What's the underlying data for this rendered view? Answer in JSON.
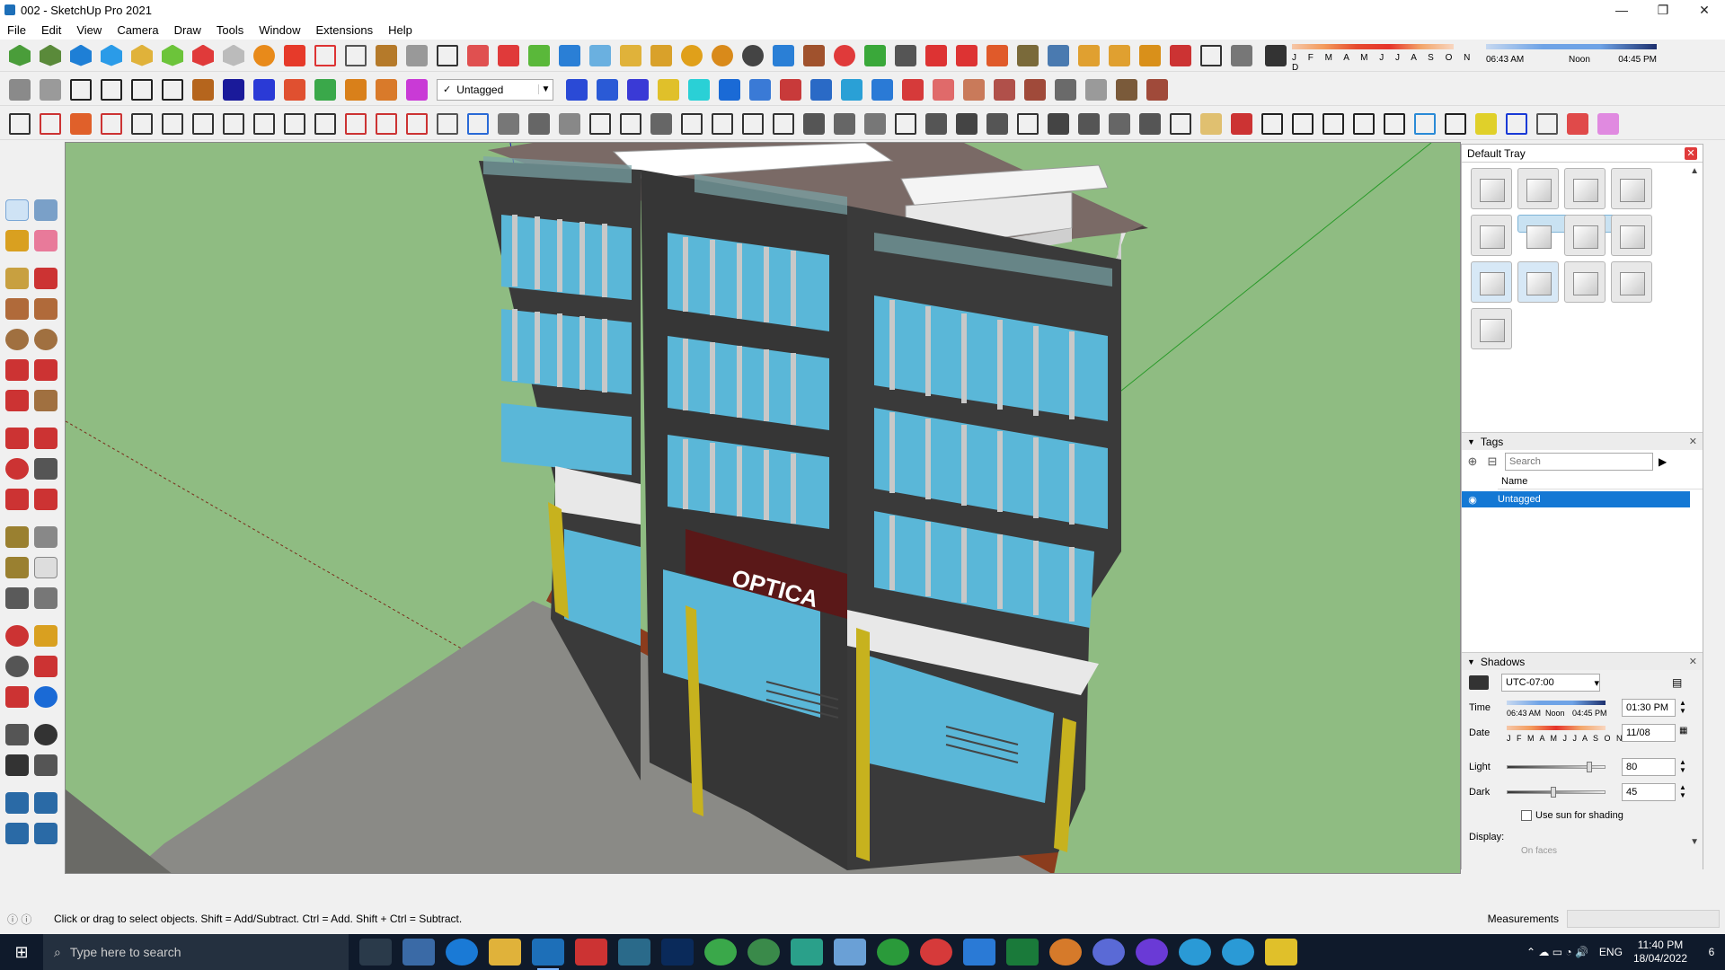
{
  "window": {
    "title": "002 - SketchUp Pro 2021",
    "controls": [
      "—",
      "❐",
      "✕"
    ]
  },
  "menu": [
    "File",
    "Edit",
    "View",
    "Camera",
    "Draw",
    "Tools",
    "Window",
    "Extensions",
    "Help"
  ],
  "toolbar": {
    "tag_selector": {
      "check": "✓",
      "value": "Untagged"
    },
    "months_label": "J F M A M J J A S O N D",
    "time_start": "06:43 AM",
    "time_noon": "Noon",
    "time_end": "04:45 PM"
  },
  "default_tray": {
    "title": "Default Tray",
    "close": "✕"
  },
  "tags_panel": {
    "title": "Tags",
    "search_placeholder": "Search",
    "column_name": "Name",
    "rows": [
      {
        "name": "Untagged",
        "selected": true
      }
    ]
  },
  "shadows_panel": {
    "title": "Shadows",
    "timezone": "UTC-07:00",
    "time_label": "Time",
    "time_start": "06:43 AM",
    "time_noon": "Noon",
    "time_end": "04:45 PM",
    "time_value": "01:30 PM",
    "date_label": "Date",
    "months_label": "J F M A M J J A S O N D",
    "date_value": "11/08",
    "light_label": "Light",
    "light_value": "80",
    "dark_label": "Dark",
    "dark_value": "45",
    "use_sun_label": "Use sun for shading",
    "display_label": "Display:",
    "on_faces_label": "On faces"
  },
  "viewport": {
    "storefront_sign": "OPTICA"
  },
  "status": {
    "message": "Click or drag to select objects. Shift = Add/Subtract. Ctrl = Add. Shift + Ctrl = Subtract.",
    "measurements_label": "Measurements"
  },
  "taskbar": {
    "search_placeholder": "Type here to search",
    "lang": "ENG",
    "time": "11:40 PM",
    "date": "18/04/2022",
    "notification_count": "6"
  },
  "colors": {
    "sky": "#8fbc82",
    "facade": "#3a3a3a",
    "glass": "#5ab7d8",
    "selection": "#1478d4",
    "floor": "#8a8a86",
    "wood": "#8b3c1d",
    "column": "#c7b21e"
  }
}
